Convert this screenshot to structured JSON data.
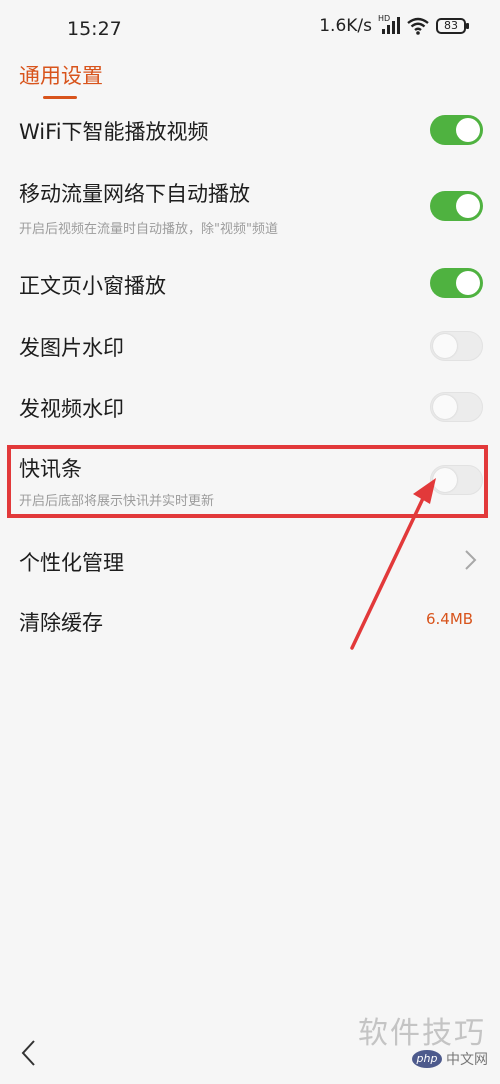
{
  "status_bar": {
    "time": "15:27",
    "network_speed": "1.6K/s",
    "hd_mark": "HD",
    "battery": "83"
  },
  "section": {
    "title": "通用设置"
  },
  "settings": [
    {
      "label": "WiFi下智能播放视频",
      "toggle": "on"
    },
    {
      "label": "移动流量网络下自动播放",
      "sub": "开启后视频在流量时自动播放，除\"视频\"频道",
      "toggle": "on"
    },
    {
      "label": "正文页小窗播放",
      "toggle": "on"
    },
    {
      "label": "发图片水印",
      "toggle": "off"
    },
    {
      "label": "发视频水印",
      "toggle": "off"
    },
    {
      "label": "快讯条",
      "sub": "开启后底部将展示快讯并实时更新",
      "toggle": "off"
    }
  ],
  "personalization": {
    "label": "个性化管理"
  },
  "clear_cache": {
    "label": "清除缓存",
    "value": "6.4MB"
  },
  "watermark": {
    "text": "软件技巧",
    "php": "php",
    "site": "中文网"
  },
  "colors": {
    "accent": "#d8541c",
    "toggle_on": "#4fb240",
    "annotation_red": "#e2393a"
  }
}
